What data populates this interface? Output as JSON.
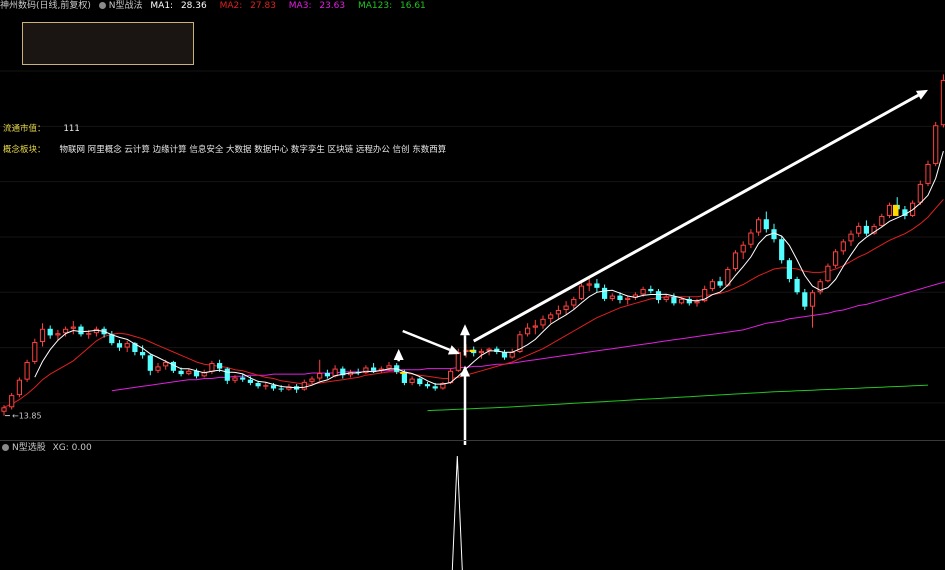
{
  "header": {
    "stock_name": "神州数码",
    "period": "(日线,前复权)",
    "indicator": "N型战法",
    "ma1_label": "MA1:",
    "ma1_value": "28.36",
    "ma2_label": "MA2:",
    "ma2_value": "27.83",
    "ma3_label": "MA3:",
    "ma3_value": "23.63",
    "ma123_label": "MA123:",
    "ma123_value": "16.61"
  },
  "info": {
    "float_mv_label": "流通市值：",
    "float_mv_value": "111",
    "concept_label": "概念板块：",
    "concept_value": "物联网 阿里概念 云计算 边缘计算 信息安全 大数据 数据中心 数字孪生 区块链 远程办公 信创 东数西算"
  },
  "sub": {
    "indicator": "N型选股",
    "xg_label": "XG:",
    "xg_value": "0.00"
  },
  "colors": {
    "up": "#ff4040",
    "down": "#54ffff",
    "ma1": "#ffffff",
    "ma2": "#e02020",
    "ma3": "#e020e0",
    "ma123": "#22c422",
    "signal": "#ffd900",
    "header_text": "#c8c8c8"
  },
  "chart_data": {
    "type": "candlestick",
    "low_marker_label": "13.85",
    "ohlc": [
      [
        14.2,
        14.8,
        13.85,
        14.6
      ],
      [
        14.6,
        15.9,
        14.4,
        15.7
      ],
      [
        15.7,
        17.3,
        15.5,
        17.1
      ],
      [
        17.1,
        18.9,
        16.9,
        18.7
      ],
      [
        18.7,
        20.8,
        18.5,
        20.5
      ],
      [
        20.5,
        22.2,
        20.1,
        21.7
      ],
      [
        21.7,
        22.0,
        20.8,
        21.1
      ],
      [
        21.1,
        21.6,
        20.6,
        21.3
      ],
      [
        21.3,
        21.9,
        21.0,
        21.7
      ],
      [
        21.7,
        22.4,
        21.2,
        21.9
      ],
      [
        21.9,
        22.1,
        21.0,
        21.2
      ],
      [
        21.2,
        21.6,
        20.8,
        21.3
      ],
      [
        21.3,
        21.9,
        21.0,
        21.7
      ],
      [
        21.7,
        21.9,
        20.9,
        21.2
      ],
      [
        21.2,
        21.5,
        20.2,
        20.4
      ],
      [
        20.4,
        20.7,
        19.7,
        20.0
      ],
      [
        20.0,
        20.6,
        19.6,
        20.4
      ],
      [
        20.4,
        20.5,
        19.3,
        19.6
      ],
      [
        19.6,
        20.2,
        19.0,
        19.3
      ],
      [
        19.3,
        19.4,
        17.5,
        17.9
      ],
      [
        17.9,
        18.6,
        17.7,
        18.3
      ],
      [
        18.3,
        18.9,
        18.0,
        18.7
      ],
      [
        18.7,
        18.8,
        17.7,
        17.9
      ],
      [
        17.9,
        18.2,
        17.4,
        17.6
      ],
      [
        17.6,
        18.1,
        17.5,
        17.9
      ],
      [
        17.9,
        18.1,
        17.2,
        17.4
      ],
      [
        17.4,
        18.0,
        17.3,
        17.8
      ],
      [
        17.8,
        18.8,
        17.6,
        18.6
      ],
      [
        18.6,
        18.9,
        17.8,
        18.1
      ],
      [
        18.1,
        18.2,
        16.7,
        17.0
      ],
      [
        17.0,
        17.5,
        16.8,
        17.3
      ],
      [
        17.3,
        17.6,
        16.9,
        17.1
      ],
      [
        17.1,
        17.4,
        16.6,
        16.8
      ],
      [
        16.8,
        17.0,
        16.3,
        16.5
      ],
      [
        16.5,
        16.9,
        16.2,
        16.6
      ],
      [
        16.6,
        16.8,
        16.1,
        16.3
      ],
      [
        16.3,
        16.6,
        16.0,
        16.2
      ],
      [
        16.2,
        16.7,
        16.1,
        16.5
      ],
      [
        16.5,
        16.7,
        15.9,
        16.2
      ],
      [
        16.2,
        17.1,
        16.1,
        16.9
      ],
      [
        16.9,
        17.4,
        16.7,
        17.2
      ],
      [
        17.2,
        18.9,
        17.0,
        17.7
      ],
      [
        17.7,
        18.0,
        17.2,
        17.4
      ],
      [
        17.4,
        18.4,
        17.3,
        18.1
      ],
      [
        18.1,
        18.3,
        17.2,
        17.5
      ],
      [
        17.5,
        18.0,
        17.3,
        17.8
      ],
      [
        17.8,
        18.1,
        17.5,
        17.7
      ],
      [
        17.7,
        18.4,
        17.6,
        18.2
      ],
      [
        18.2,
        18.6,
        17.7,
        17.9
      ],
      [
        17.9,
        18.3,
        17.7,
        18.1
      ],
      [
        18.1,
        18.7,
        17.9,
        18.4
      ],
      [
        18.4,
        18.6,
        17.6,
        17.8
      ],
      [
        17.8,
        18.0,
        16.6,
        16.8
      ],
      [
        16.8,
        17.4,
        16.6,
        17.2
      ],
      [
        17.2,
        17.3,
        16.5,
        16.7
      ],
      [
        16.7,
        16.9,
        16.3,
        16.5
      ],
      [
        16.5,
        16.8,
        16.1,
        16.3
      ],
      [
        16.3,
        16.9,
        16.2,
        16.8
      ],
      [
        16.8,
        18.1,
        16.7,
        17.9
      ],
      [
        17.9,
        19.9,
        17.8,
        19.6
      ],
      [
        19.6,
        20.3,
        19.1,
        19.8
      ],
      [
        19.8,
        20.1,
        19.2,
        19.5
      ],
      [
        19.5,
        19.9,
        19.0,
        19.7
      ],
      [
        19.7,
        20.0,
        19.3,
        19.9
      ],
      [
        19.9,
        20.1,
        19.4,
        19.6
      ],
      [
        19.6,
        19.8,
        18.9,
        19.1
      ],
      [
        19.1,
        19.9,
        19.0,
        19.6
      ],
      [
        19.6,
        21.5,
        19.5,
        21.2
      ],
      [
        21.2,
        22.2,
        21.0,
        21.8
      ],
      [
        21.8,
        22.5,
        21.2,
        22.0
      ],
      [
        22.0,
        22.9,
        21.7,
        22.6
      ],
      [
        22.6,
        23.2,
        22.2,
        23.0
      ],
      [
        23.0,
        23.8,
        22.6,
        23.4
      ],
      [
        23.4,
        24.2,
        23.0,
        23.8
      ],
      [
        23.8,
        24.6,
        23.5,
        24.4
      ],
      [
        24.4,
        25.8,
        24.3,
        25.6
      ],
      [
        25.6,
        26.3,
        25.1,
        25.8
      ],
      [
        25.8,
        26.2,
        25.0,
        25.4
      ],
      [
        25.4,
        25.7,
        24.2,
        24.4
      ],
      [
        24.4,
        24.9,
        24.2,
        24.7
      ],
      [
        24.7,
        25.0,
        24.0,
        24.3
      ],
      [
        24.3,
        24.7,
        23.9,
        24.5
      ],
      [
        24.5,
        25.0,
        24.3,
        24.8
      ],
      [
        24.8,
        25.5,
        24.6,
        25.3
      ],
      [
        25.3,
        25.6,
        24.9,
        25.1
      ],
      [
        25.1,
        25.3,
        24.0,
        24.3
      ],
      [
        24.3,
        24.8,
        24.1,
        24.6
      ],
      [
        24.6,
        24.9,
        23.8,
        24.0
      ],
      [
        24.0,
        24.5,
        23.9,
        24.4
      ],
      [
        24.4,
        24.6,
        23.8,
        24.0
      ],
      [
        24.0,
        24.4,
        23.7,
        24.2
      ],
      [
        24.2,
        25.6,
        24.1,
        25.3
      ],
      [
        25.3,
        26.2,
        25.1,
        26.0
      ],
      [
        26.0,
        26.4,
        25.4,
        25.6
      ],
      [
        25.6,
        27.3,
        25.5,
        27.1
      ],
      [
        27.1,
        28.8,
        26.9,
        28.6
      ],
      [
        28.6,
        29.6,
        28.0,
        29.3
      ],
      [
        29.3,
        30.7,
        29.0,
        30.4
      ],
      [
        30.4,
        31.8,
        30.1,
        31.6
      ],
      [
        31.6,
        32.3,
        30.4,
        30.7
      ],
      [
        30.7,
        31.2,
        29.5,
        29.8
      ],
      [
        29.8,
        30.1,
        27.6,
        27.9
      ],
      [
        27.9,
        28.1,
        25.9,
        26.2
      ],
      [
        26.2,
        26.4,
        24.8,
        25.0
      ],
      [
        25.0,
        25.3,
        23.4,
        23.7
      ],
      [
        23.7,
        25.2,
        21.8,
        25.0
      ],
      [
        25.0,
        26.2,
        24.8,
        26.0
      ],
      [
        26.0,
        27.6,
        25.9,
        27.4
      ],
      [
        27.4,
        28.9,
        27.2,
        28.7
      ],
      [
        28.7,
        29.8,
        28.4,
        29.6
      ],
      [
        29.6,
        30.6,
        29.2,
        30.3
      ],
      [
        30.3,
        31.3,
        30.0,
        31.0
      ],
      [
        31.0,
        31.5,
        30.1,
        30.3
      ],
      [
        30.3,
        31.2,
        30.2,
        31.0
      ],
      [
        31.0,
        32.1,
        30.9,
        31.9
      ],
      [
        31.9,
        33.1,
        31.7,
        32.9
      ],
      [
        32.9,
        33.6,
        32.2,
        32.5
      ],
      [
        32.5,
        32.8,
        31.6,
        31.9
      ],
      [
        31.9,
        33.3,
        31.8,
        33.1
      ],
      [
        33.1,
        35.1,
        32.9,
        34.8
      ],
      [
        34.8,
        36.9,
        34.6,
        36.6
      ],
      [
        36.6,
        40.4,
        36.4,
        40.1
      ],
      [
        40.1,
        44.7,
        39.9,
        44.2
      ]
    ],
    "ma2": [
      14.6,
      14.9,
      15.3,
      15.8,
      16.4,
      17.1,
      17.6,
      18.0,
      18.4,
      18.8,
      19.4,
      20.0,
      20.6,
      21.0,
      21.2,
      21.3,
      21.2,
      21.0,
      20.8,
      20.5,
      20.2,
      19.9,
      19.6,
      19.3,
      19.0,
      18.7,
      18.5,
      18.4,
      18.3,
      18.2,
      18.0,
      17.9,
      17.7,
      17.5,
      17.3,
      17.2,
      17.0,
      16.9,
      16.8,
      16.7,
      16.7,
      16.8,
      16.9,
      17.0,
      17.1,
      17.2,
      17.3,
      17.5,
      17.6,
      17.7,
      17.8,
      17.8,
      17.7,
      17.6,
      17.5,
      17.4,
      17.3,
      17.2,
      17.2,
      17.3,
      17.5,
      17.7,
      17.9,
      18.1,
      18.3,
      18.5,
      18.7,
      19.0,
      19.3,
      19.6,
      19.9,
      20.3,
      20.7,
      21.1,
      21.5,
      21.9,
      22.3,
      22.7,
      23.0,
      23.3,
      23.6,
      23.8,
      24.0,
      24.2,
      24.4,
      24.5,
      24.6,
      24.6,
      24.6,
      24.6,
      24.6,
      24.7,
      24.8,
      24.9,
      25.1,
      25.4,
      25.7,
      26.1,
      26.5,
      26.8,
      27.1,
      27.2,
      27.2,
      27.1,
      26.9,
      26.8,
      26.8,
      26.9,
      27.1,
      27.4,
      27.8,
      28.2,
      28.5,
      28.9,
      29.3,
      29.7,
      30.0,
      30.3,
      30.7,
      31.2,
      31.8,
      32.6,
      33.4
    ],
    "ma3": [
      null,
      null,
      null,
      null,
      null,
      null,
      null,
      null,
      null,
      null,
      null,
      null,
      null,
      null,
      16.1,
      16.2,
      16.3,
      16.4,
      16.5,
      16.6,
      16.7,
      16.8,
      16.9,
      17.0,
      17.1,
      17.1,
      17.2,
      17.2,
      17.3,
      17.3,
      17.4,
      17.4,
      17.5,
      17.5,
      17.5,
      17.6,
      17.6,
      17.6,
      17.6,
      17.6,
      17.7,
      17.7,
      17.7,
      17.7,
      17.8,
      17.8,
      17.8,
      17.8,
      17.9,
      17.9,
      17.9,
      18.0,
      18.0,
      18.0,
      18.0,
      18.1,
      18.1,
      18.1,
      18.1,
      18.2,
      18.2,
      18.3,
      18.3,
      18.4,
      18.5,
      18.5,
      18.6,
      18.7,
      18.8,
      18.9,
      19.0,
      19.1,
      19.2,
      19.3,
      19.4,
      19.5,
      19.6,
      19.7,
      19.8,
      19.9,
      20.0,
      20.1,
      20.2,
      20.3,
      20.4,
      20.5,
      20.6,
      20.7,
      20.8,
      20.9,
      21.0,
      21.1,
      21.2,
      21.3,
      21.4,
      21.5,
      21.6,
      21.8,
      22.0,
      22.2,
      22.3,
      22.4,
      22.6,
      22.7,
      22.8,
      22.9,
      23.0,
      23.1,
      23.3,
      23.4,
      23.6,
      23.8,
      23.9,
      24.1,
      24.3,
      24.5,
      24.7,
      24.9,
      25.1,
      25.3,
      25.5,
      25.7,
      25.9,
      26.1
    ],
    "ma123": [
      null,
      null,
      null,
      null,
      null,
      null,
      null,
      null,
      null,
      null,
      null,
      null,
      null,
      null,
      null,
      null,
      null,
      null,
      null,
      null,
      null,
      null,
      null,
      null,
      null,
      null,
      null,
      null,
      null,
      null,
      null,
      null,
      null,
      null,
      null,
      null,
      null,
      null,
      null,
      null,
      null,
      null,
      null,
      null,
      null,
      null,
      null,
      null,
      null,
      null,
      null,
      null,
      null,
      null,
      null,
      14.3,
      14.33,
      14.36,
      14.39,
      14.42,
      14.45,
      14.48,
      14.51,
      14.54,
      14.57,
      14.6,
      14.64,
      14.68,
      14.72,
      14.76,
      14.8,
      14.84,
      14.88,
      14.92,
      14.96,
      15.0,
      15.04,
      15.08,
      15.12,
      15.16,
      15.2,
      15.24,
      15.28,
      15.32,
      15.36,
      15.4,
      15.44,
      15.48,
      15.52,
      15.56,
      15.6,
      15.64,
      15.68,
      15.72,
      15.76,
      15.8,
      15.84,
      15.88,
      15.92,
      15.96,
      16.0,
      16.03,
      16.06,
      16.09,
      16.12,
      16.15,
      16.18,
      16.21,
      16.24,
      16.27,
      16.3,
      16.33,
      16.36,
      16.39,
      16.42,
      16.45,
      16.48,
      16.51,
      16.54,
      16.57,
      16.61
    ],
    "signal_bars": [
      51,
      60,
      115
    ],
    "xg_signal_index": 59,
    "ylim": [
      13.0,
      46.0
    ]
  }
}
